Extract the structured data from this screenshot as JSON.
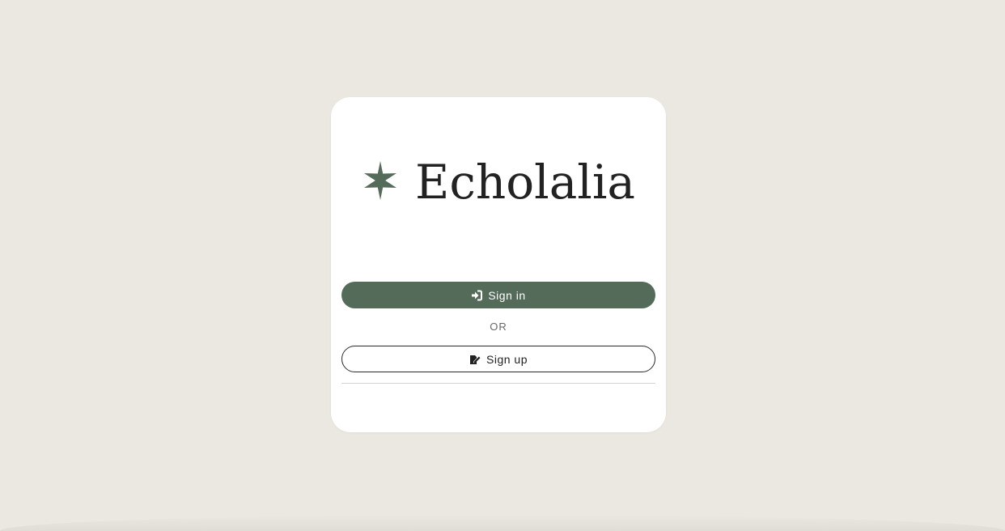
{
  "app": {
    "name": "Echolalia",
    "logo_icon": "star-icon"
  },
  "auth": {
    "signin_label": "Sign in",
    "signin_icon": "sign-in-icon",
    "or_label": "OR",
    "signup_label": "Sign up",
    "signup_icon": "edit-icon"
  },
  "colors": {
    "background": "#eae8e1",
    "card": "#ffffff",
    "accent": "#546b5a",
    "text": "#222222"
  }
}
